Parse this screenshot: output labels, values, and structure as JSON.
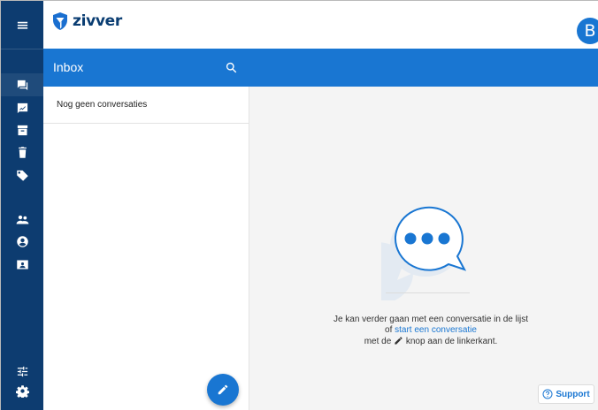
{
  "app": {
    "brand": "zivver",
    "avatar_initial": "B"
  },
  "rail": {
    "items": [
      {
        "name": "menu-icon"
      },
      {
        "name": "inbox-icon",
        "active": true
      },
      {
        "name": "sent-icon"
      },
      {
        "name": "archive-icon"
      },
      {
        "name": "trash-icon"
      },
      {
        "name": "label-icon"
      },
      {
        "name": "contacts-icon"
      },
      {
        "name": "account-icon"
      },
      {
        "name": "contact-card-icon"
      },
      {
        "name": "settings-sliders-icon"
      },
      {
        "name": "gear-icon"
      }
    ]
  },
  "header": {
    "title": "Inbox"
  },
  "list": {
    "empty_message": "Nog geen conversaties"
  },
  "main": {
    "line1": "Je kan verder gaan met een conversatie in de lijst",
    "line2_prefix": "of ",
    "line2_link": "start een conversatie",
    "line3_prefix": "met de ",
    "line3_suffix": " knop aan de linkerkant.",
    "support_label": "Support"
  },
  "colors": {
    "rail": "#0d3c70",
    "accent": "#1976d2",
    "background": "#f4f4f4"
  }
}
